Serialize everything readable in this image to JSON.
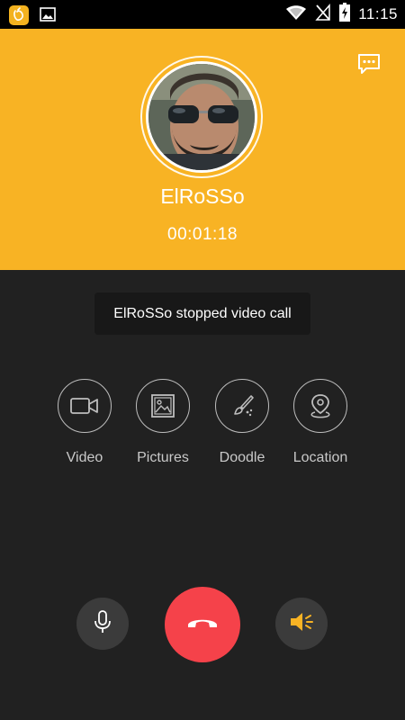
{
  "status_bar": {
    "app_icon": "app-badge-icon",
    "notification_icon": "image-icon",
    "wifi_icon": "wifi-icon",
    "signal_icon": "no-signal-icon",
    "battery_icon": "battery-charging-icon",
    "time": "11:15"
  },
  "call": {
    "caller_name": "ElRoSSo",
    "timer": "00:01:18",
    "toast": "ElRoSSo stopped video call"
  },
  "actions": [
    {
      "label": "Video",
      "icon": "video-camera-icon"
    },
    {
      "label": "Pictures",
      "icon": "picture-icon"
    },
    {
      "label": "Doodle",
      "icon": "paintbrush-icon"
    },
    {
      "label": "Location",
      "icon": "location-pin-icon"
    }
  ],
  "controls": {
    "mute_icon": "microphone-icon",
    "end_icon": "phone-hangup-icon",
    "speaker_icon": "speaker-icon"
  },
  "colors": {
    "header": "#f8b324",
    "background": "#212121",
    "end_call": "#f5424a",
    "speaker_accent": "#f8b324"
  }
}
